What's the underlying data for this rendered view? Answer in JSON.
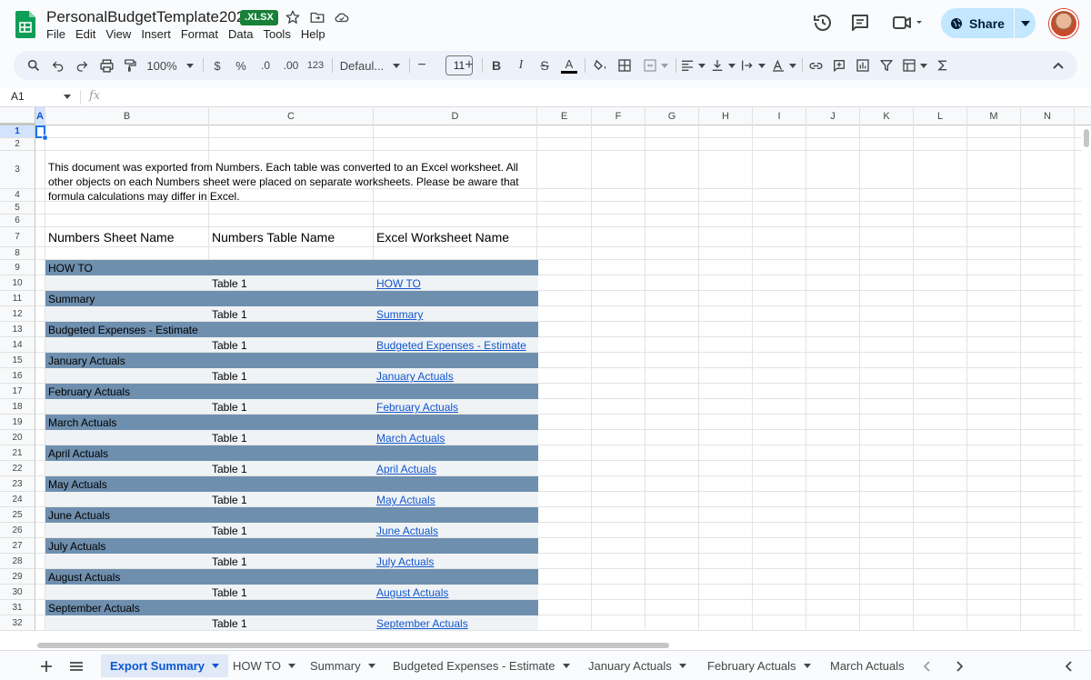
{
  "title_bar": {
    "doc_title": "PersonalBudgetTemplate2024",
    "file_badge": "XLSX",
    "menu": [
      "File",
      "Edit",
      "View",
      "Insert",
      "Format",
      "Data",
      "Tools",
      "Help"
    ],
    "share_label": "Share",
    "share_color": "#c2e7ff"
  },
  "toolbar": {
    "zoom": "100%",
    "currency_symbol": "$",
    "percent_symbol": "%",
    "decrease_decimal": ".0",
    "increase_decimal": ".00",
    "number_format": "123",
    "font_name": "Defaul...",
    "font_size": "11",
    "minus": "−",
    "plus": "+",
    "bold": "B",
    "italic": "I",
    "strikethrough": "S",
    "text_color": "A"
  },
  "formula_bar": {
    "cell_ref": "A1",
    "fx_label": "fx"
  },
  "grid": {
    "columns": [
      "A",
      "B",
      "C",
      "D",
      "E",
      "F",
      "G",
      "H",
      "I",
      "J",
      "K",
      "L",
      "M",
      "N"
    ],
    "rows": [
      "1",
      "2",
      "3",
      "4",
      "5",
      "6",
      "7",
      "8",
      "9",
      "10",
      "11",
      "12",
      "13",
      "14",
      "15",
      "16",
      "17",
      "18",
      "19",
      "20",
      "21",
      "22",
      "23",
      "24",
      "25",
      "26",
      "27",
      "28",
      "29",
      "30",
      "31",
      "32"
    ],
    "note": "This document was exported from Numbers.  Each table was converted to an Excel worksheet. All other objects on each Numbers sheet were placed on separate worksheets. Please be aware that formula calculations may differ in Excel.",
    "headers": {
      "sheet_name": "Numbers Sheet Name",
      "table_name": "Numbers Table Name",
      "worksheet_name": "Excel Worksheet Name"
    },
    "entries": [
      {
        "sheet": "HOW TO",
        "table": "Table 1",
        "link": "HOW TO"
      },
      {
        "sheet": "Summary",
        "table": "Table 1",
        "link": "Summary"
      },
      {
        "sheet": "Budgeted Expenses - Estimate",
        "table": "Table 1",
        "link": "Budgeted Expenses - Estimate"
      },
      {
        "sheet": "January Actuals",
        "table": "Table 1",
        "link": "January Actuals"
      },
      {
        "sheet": "February Actuals",
        "table": "Table 1",
        "link": "February Actuals"
      },
      {
        "sheet": "March Actuals",
        "table": "Table 1",
        "link": "March Actuals"
      },
      {
        "sheet": "April Actuals",
        "table": "Table 1",
        "link": "April Actuals"
      },
      {
        "sheet": "May Actuals",
        "table": "Table 1",
        "link": "May Actuals"
      },
      {
        "sheet": "June Actuals",
        "table": "Table 1",
        "link": "June Actuals"
      },
      {
        "sheet": "July Actuals",
        "table": "Table 1",
        "link": "July Actuals"
      },
      {
        "sheet": "August Actuals",
        "table": "Table 1",
        "link": "August Actuals"
      },
      {
        "sheet": "September Actuals",
        "table": "Table 1",
        "link": "September Actuals"
      }
    ],
    "band_dark_color": "#6f8fae",
    "band_light_color": "#eff3f6",
    "link_color": "#1155cc"
  },
  "sheet_tabs": {
    "tabs": [
      "Export Summary",
      "HOW TO",
      "Summary",
      "Budgeted Expenses - Estimate",
      "January Actuals",
      "February Actuals",
      "March Actuals"
    ],
    "active": "Export Summary"
  }
}
